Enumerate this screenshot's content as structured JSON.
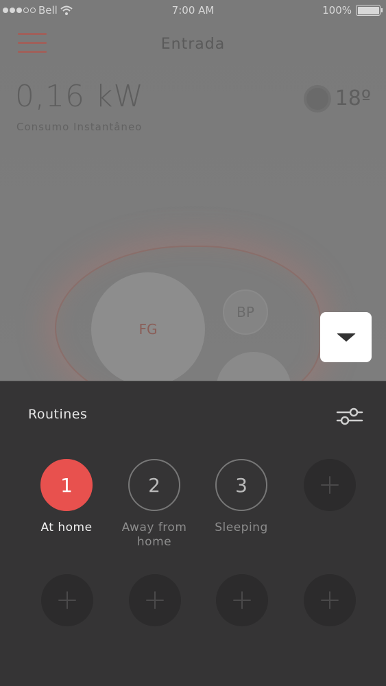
{
  "status_bar": {
    "carrier": "Bell",
    "time": "7:00 AM",
    "battery": "100%",
    "battery_level": 1.0,
    "icons": [
      "signal-icon",
      "wifi-icon",
      "battery-icon"
    ]
  },
  "header": {
    "title": "Entrada",
    "menu_icon": "hamburger-icon"
  },
  "stats": {
    "power": "0,16 kW",
    "power_caption": "Consumo Instantâneo",
    "temperature": "18º",
    "weather_icon": "sun-icon"
  },
  "zones": {
    "fg_label": "FG",
    "bp_label": "BP"
  },
  "panel": {
    "title": "Routines",
    "settings_icon": "sliders-icon",
    "collapse_icon": "caret-down-icon",
    "routines": [
      {
        "number": "1",
        "label": "At home",
        "active": true
      },
      {
        "number": "2",
        "label": "Away from home",
        "active": false
      },
      {
        "number": "3",
        "label": "Sleeping",
        "active": false
      }
    ],
    "add_icon": "plus-icon"
  },
  "colors": {
    "accent": "#e8514e",
    "panel_bg": "#353435",
    "slot_bg": "#2c2b2c"
  }
}
